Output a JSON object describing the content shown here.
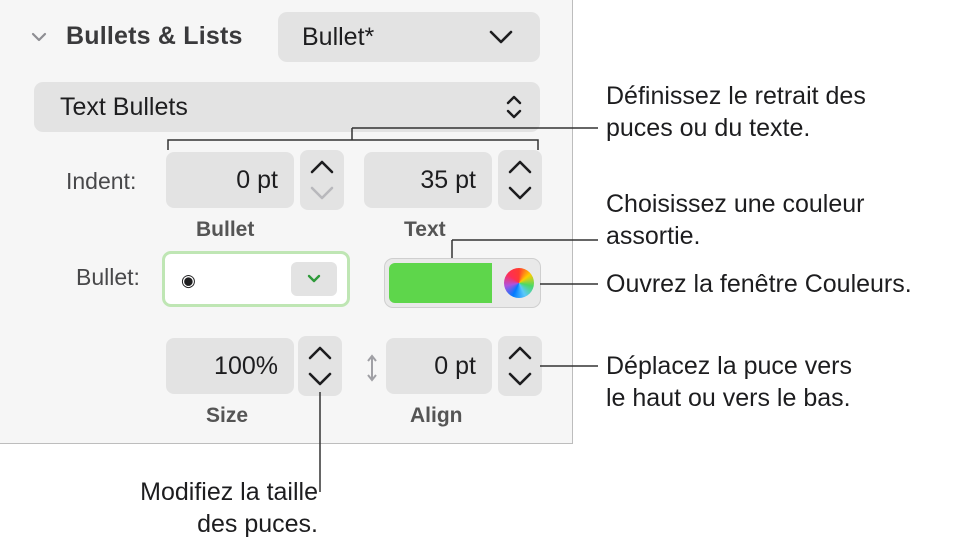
{
  "section": {
    "title": "Bullets & Lists",
    "style_value": "Bullet*"
  },
  "bullet_type": {
    "value": "Text Bullets"
  },
  "indent": {
    "label": "Indent:",
    "bullet_value": "0 pt",
    "bullet_sublabel": "Bullet",
    "text_value": "35 pt",
    "text_sublabel": "Text"
  },
  "bullet": {
    "label": "Bullet:",
    "glyph": "◉",
    "color": "#5ed64b"
  },
  "size": {
    "value": "100%",
    "sublabel": "Size"
  },
  "align": {
    "value": "0 pt",
    "sublabel": "Align"
  },
  "callouts": {
    "indent_line1": "Définissez le retrait des",
    "indent_line2": "puces ou du texte.",
    "color_line1": "Choisissez une couleur",
    "color_line2": "assortie.",
    "colors_window": "Ouvrez la fenêtre Couleurs.",
    "align_line1": "Déplacez la puce vers",
    "align_line2": "le haut ou vers le bas.",
    "size_line1": "Modifiez la taille",
    "size_line2": "des puces."
  }
}
